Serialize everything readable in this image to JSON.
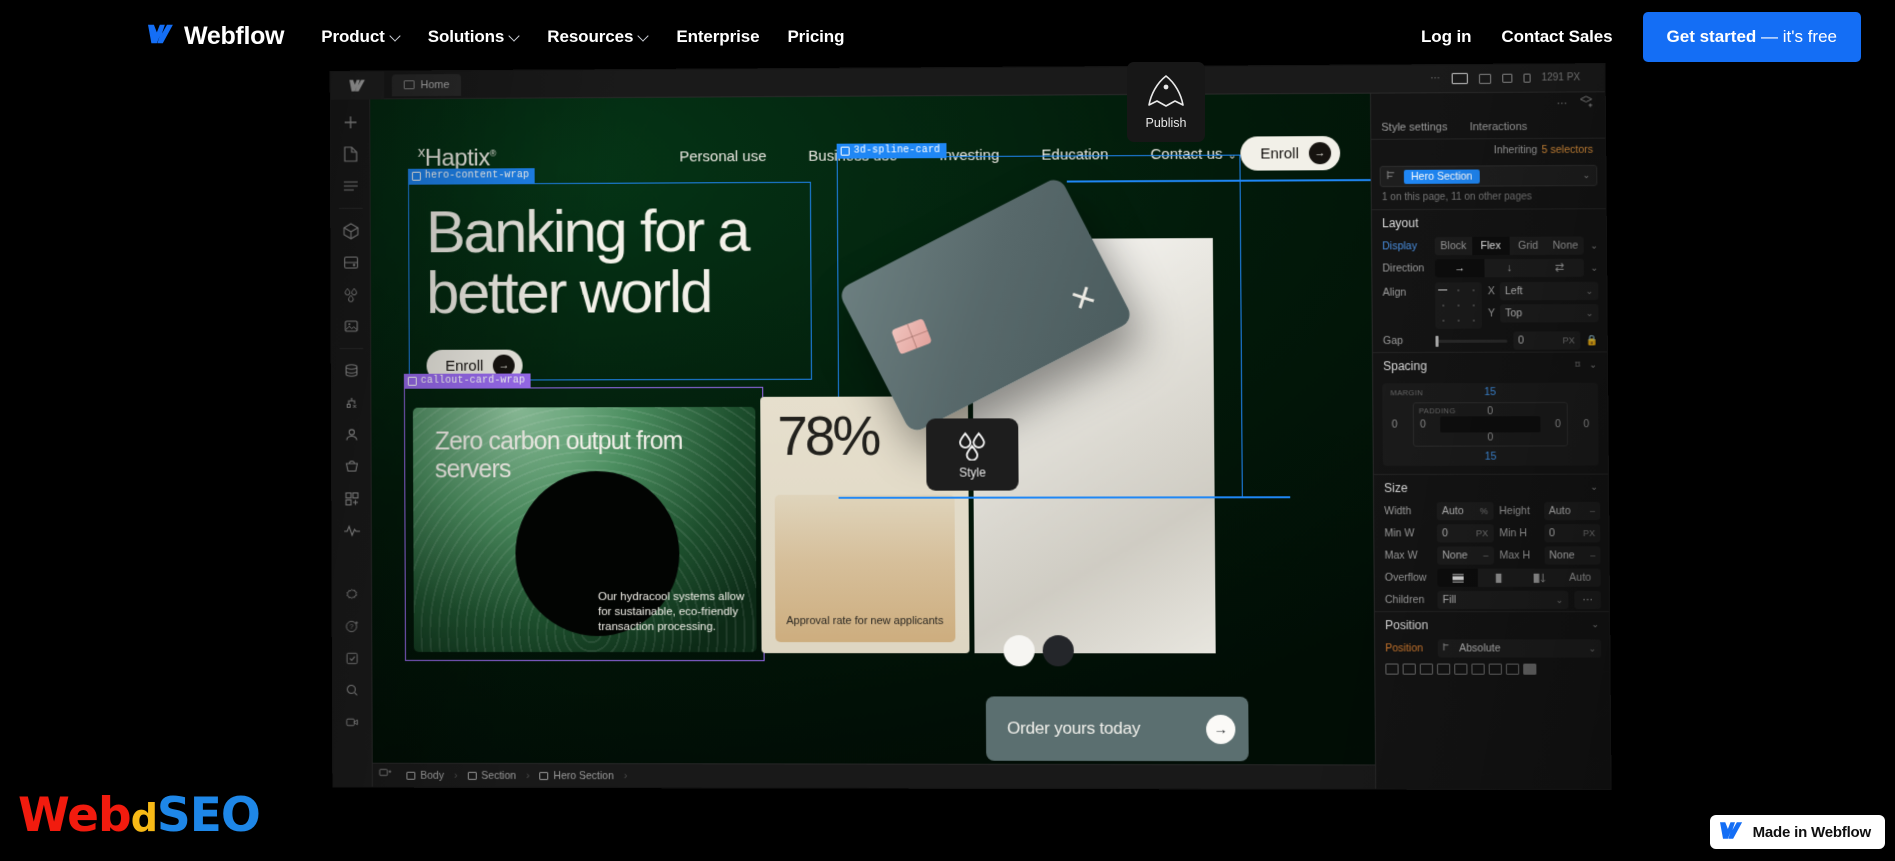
{
  "topnav": {
    "brand": "Webflow",
    "brand_icon": "webflow-logo-icon",
    "links": [
      {
        "label": "Product",
        "has_caret": true
      },
      {
        "label": "Solutions",
        "has_caret": true
      },
      {
        "label": "Resources",
        "has_caret": true
      },
      {
        "label": "Enterprise",
        "has_caret": false
      },
      {
        "label": "Pricing",
        "has_caret": false
      }
    ],
    "login": "Log in",
    "contact_sales": "Contact Sales",
    "cta_bold": "Get started",
    "cta_light": " — it's free",
    "cta_color": "#146EF5"
  },
  "designer": {
    "topbar": {
      "page_tab": "Home",
      "more_icon": "ellipsis-icon",
      "viewport_px": "1291 PX"
    },
    "rail_icons": [
      "add-icon",
      "pages-icon",
      "navigator-icon",
      "components-icon",
      "variables-icon",
      "assets-icon",
      "images-icon",
      "cms-icon",
      "logic-icon",
      "users-icon",
      "ecommerce-icon",
      "apps-icon",
      "audit-icon"
    ],
    "rail_bottom_icons": [
      "settings-icon",
      "help-icon",
      "checklist-icon",
      "zoom-icon",
      "video-icon"
    ],
    "breadcrumbs": [
      "Body",
      "Section",
      "Hero Section"
    ],
    "selection_tags": [
      {
        "label": "hero-content-wrap",
        "color": "#1f87f5"
      },
      {
        "label": "3d-spline-card",
        "color": "#1f87f5"
      },
      {
        "label": "callout-card-wrap",
        "color": "#9b6cf2"
      }
    ],
    "publish_tooltip": {
      "label": "Publish",
      "icon": "rocket-icon"
    },
    "style_tooltip": {
      "label": "Style",
      "icon": "water-drops-icon"
    }
  },
  "site": {
    "logo": "Haptix",
    "logo_prefix": "x",
    "logo_suffix": "®",
    "nav_links": [
      {
        "label": "Personal use",
        "dropdown": false
      },
      {
        "label": "Business use",
        "dropdown": false
      },
      {
        "label": "Investing",
        "dropdown": false
      },
      {
        "label": "Education",
        "dropdown": false
      },
      {
        "label": "Contact us",
        "dropdown": true
      }
    ],
    "nav_cta": "Enroll",
    "hero_heading_line1": "Banking for a",
    "hero_heading_line2": "better world",
    "hero_cta": "Enroll",
    "cards": {
      "green": {
        "heading": "Zero carbon output from servers",
        "body": "Our hydracool systems allow for sustainable, eco-friendly transaction processing."
      },
      "tan": {
        "stat": "78%",
        "caption": "Approval rate for new applicants"
      },
      "grey": {
        "cta": "Order yours today",
        "swatches": [
          "#f6f5f2",
          "#24262a"
        ]
      }
    }
  },
  "inspector": {
    "tabs": [
      {
        "label": "Style settings",
        "active": false
      },
      {
        "label": "Interactions",
        "active": false
      }
    ],
    "inherit_prefix": "Inheriting",
    "inherit_value": "5 selectors",
    "inherit_color": "#d98f3b",
    "selector_chip": "Hero Section",
    "usage_note": "1 on this page, 11 on other pages",
    "layout": {
      "title": "Layout",
      "display": {
        "label": "Display",
        "options": [
          "Block",
          "Flex",
          "Grid",
          "None"
        ],
        "selected": "Flex"
      },
      "direction": {
        "label": "Direction",
        "options": [
          "row",
          "column",
          "wrap"
        ],
        "selected": "row"
      },
      "align": {
        "label": "Align",
        "x_label": "X",
        "x_value": "Left",
        "y_label": "Y",
        "y_value": "Top"
      },
      "gap": {
        "label": "Gap",
        "value": "0",
        "unit": "PX",
        "lock_icon": "lock-icon"
      }
    },
    "spacing": {
      "title": "Spacing",
      "margin_label": "MARGIN",
      "padding_label": "PADDING",
      "margin": {
        "top": "15",
        "right": "0",
        "bottom": "15",
        "left": "0"
      },
      "padding": {
        "top": "0",
        "right": "0",
        "bottom": "0",
        "left": "0"
      }
    },
    "size": {
      "title": "Size",
      "width": {
        "label": "Width",
        "value": "Auto",
        "unit": "%"
      },
      "height": {
        "label": "Height",
        "value": "Auto",
        "unit": "–"
      },
      "min_w": {
        "label": "Min W",
        "value": "0",
        "unit": "PX"
      },
      "min_h": {
        "label": "Min H",
        "value": "0",
        "unit": "PX"
      },
      "max_w": {
        "label": "Max W",
        "value": "None",
        "unit": "–"
      },
      "max_h": {
        "label": "Max H",
        "value": "None",
        "unit": "–"
      },
      "overflow": {
        "label": "Overflow",
        "options": [
          "visible",
          "hidden",
          "scroll"
        ],
        "auto_label": "Auto"
      },
      "children": {
        "label": "Children",
        "value": "Fill",
        "more_icon": "ellipsis-icon"
      }
    },
    "position": {
      "title": "Position",
      "label": "Position",
      "value": "Absolute",
      "label_color": "#d07a2e"
    }
  },
  "watermark": {
    "part1": "Web",
    "part2": "d",
    "part3": "SEO",
    "color1": "#f21b0e",
    "color2": "#f7b916",
    "color3": "#1e87e8"
  },
  "badge": {
    "label": "Made in Webflow",
    "icon": "webflow-logo-icon"
  }
}
